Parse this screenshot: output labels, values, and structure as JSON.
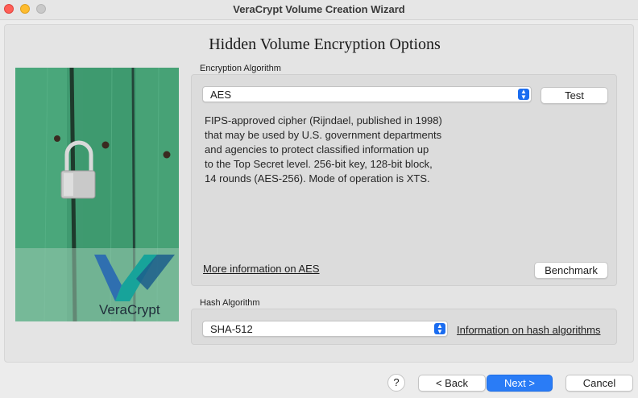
{
  "window": {
    "title": "VeraCrypt Volume Creation Wizard"
  },
  "page": {
    "title": "Hidden Volume Encryption Options"
  },
  "side_image": {
    "brand_text": "VeraCrypt"
  },
  "encryption": {
    "label": "Encryption Algorithm",
    "selected": "AES",
    "test_label": "Test",
    "description_lines": [
      "FIPS-approved cipher (Rijndael, published in 1998)",
      "that may be used by U.S. government departments",
      "and agencies to protect classified information up",
      "to the Top Secret level. 256-bit key, 128-bit block,",
      "14 rounds (AES-256). Mode of operation is XTS."
    ],
    "more_info_link": "More information on AES",
    "benchmark_label": "Benchmark"
  },
  "hash": {
    "label": "Hash Algorithm",
    "selected": "SHA-512",
    "info_link": "Information on hash algorithms"
  },
  "footer": {
    "help_label": "?",
    "back_label": "< Back",
    "next_label": "Next >",
    "cancel_label": "Cancel"
  },
  "colors": {
    "accent": "#2a7cf6",
    "select_arrow": "#1a6cf0"
  }
}
